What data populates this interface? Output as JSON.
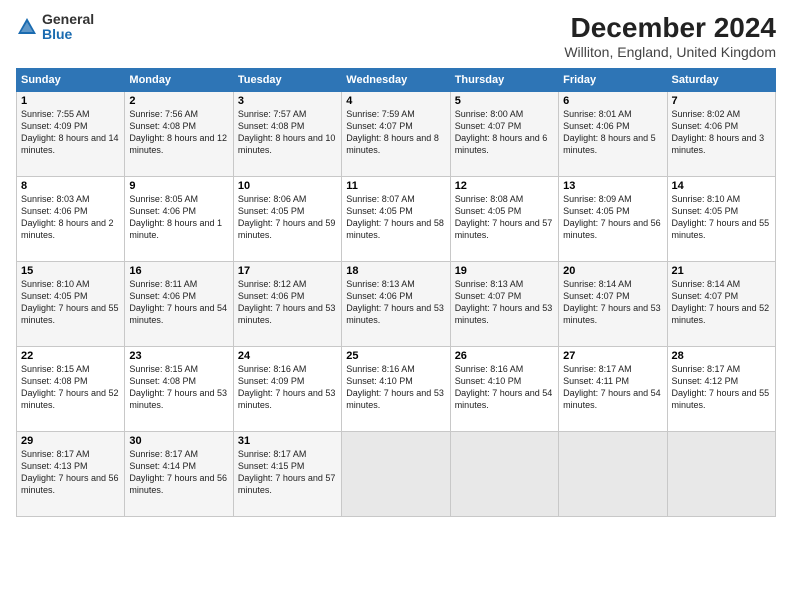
{
  "logo": {
    "general": "General",
    "blue": "Blue"
  },
  "title": "December 2024",
  "subtitle": "Williton, England, United Kingdom",
  "headers": [
    "Sunday",
    "Monday",
    "Tuesday",
    "Wednesday",
    "Thursday",
    "Friday",
    "Saturday"
  ],
  "weeks": [
    [
      {
        "day": "1",
        "sunrise": "7:55 AM",
        "sunset": "4:09 PM",
        "daylight": "8 hours and 14 minutes."
      },
      {
        "day": "2",
        "sunrise": "7:56 AM",
        "sunset": "4:08 PM",
        "daylight": "8 hours and 12 minutes."
      },
      {
        "day": "3",
        "sunrise": "7:57 AM",
        "sunset": "4:08 PM",
        "daylight": "8 hours and 10 minutes."
      },
      {
        "day": "4",
        "sunrise": "7:59 AM",
        "sunset": "4:07 PM",
        "daylight": "8 hours and 8 minutes."
      },
      {
        "day": "5",
        "sunrise": "8:00 AM",
        "sunset": "4:07 PM",
        "daylight": "8 hours and 6 minutes."
      },
      {
        "day": "6",
        "sunrise": "8:01 AM",
        "sunset": "4:06 PM",
        "daylight": "8 hours and 5 minutes."
      },
      {
        "day": "7",
        "sunrise": "8:02 AM",
        "sunset": "4:06 PM",
        "daylight": "8 hours and 3 minutes."
      }
    ],
    [
      {
        "day": "8",
        "sunrise": "8:03 AM",
        "sunset": "4:06 PM",
        "daylight": "8 hours and 2 minutes."
      },
      {
        "day": "9",
        "sunrise": "8:05 AM",
        "sunset": "4:06 PM",
        "daylight": "8 hours and 1 minute."
      },
      {
        "day": "10",
        "sunrise": "8:06 AM",
        "sunset": "4:05 PM",
        "daylight": "7 hours and 59 minutes."
      },
      {
        "day": "11",
        "sunrise": "8:07 AM",
        "sunset": "4:05 PM",
        "daylight": "7 hours and 58 minutes."
      },
      {
        "day": "12",
        "sunrise": "8:08 AM",
        "sunset": "4:05 PM",
        "daylight": "7 hours and 57 minutes."
      },
      {
        "day": "13",
        "sunrise": "8:09 AM",
        "sunset": "4:05 PM",
        "daylight": "7 hours and 56 minutes."
      },
      {
        "day": "14",
        "sunrise": "8:10 AM",
        "sunset": "4:05 PM",
        "daylight": "7 hours and 55 minutes."
      }
    ],
    [
      {
        "day": "15",
        "sunrise": "8:10 AM",
        "sunset": "4:05 PM",
        "daylight": "7 hours and 55 minutes."
      },
      {
        "day": "16",
        "sunrise": "8:11 AM",
        "sunset": "4:06 PM",
        "daylight": "7 hours and 54 minutes."
      },
      {
        "day": "17",
        "sunrise": "8:12 AM",
        "sunset": "4:06 PM",
        "daylight": "7 hours and 53 minutes."
      },
      {
        "day": "18",
        "sunrise": "8:13 AM",
        "sunset": "4:06 PM",
        "daylight": "7 hours and 53 minutes."
      },
      {
        "day": "19",
        "sunrise": "8:13 AM",
        "sunset": "4:07 PM",
        "daylight": "7 hours and 53 minutes."
      },
      {
        "day": "20",
        "sunrise": "8:14 AM",
        "sunset": "4:07 PM",
        "daylight": "7 hours and 53 minutes."
      },
      {
        "day": "21",
        "sunrise": "8:14 AM",
        "sunset": "4:07 PM",
        "daylight": "7 hours and 52 minutes."
      }
    ],
    [
      {
        "day": "22",
        "sunrise": "8:15 AM",
        "sunset": "4:08 PM",
        "daylight": "7 hours and 52 minutes."
      },
      {
        "day": "23",
        "sunrise": "8:15 AM",
        "sunset": "4:08 PM",
        "daylight": "7 hours and 53 minutes."
      },
      {
        "day": "24",
        "sunrise": "8:16 AM",
        "sunset": "4:09 PM",
        "daylight": "7 hours and 53 minutes."
      },
      {
        "day": "25",
        "sunrise": "8:16 AM",
        "sunset": "4:10 PM",
        "daylight": "7 hours and 53 minutes."
      },
      {
        "day": "26",
        "sunrise": "8:16 AM",
        "sunset": "4:10 PM",
        "daylight": "7 hours and 54 minutes."
      },
      {
        "day": "27",
        "sunrise": "8:17 AM",
        "sunset": "4:11 PM",
        "daylight": "7 hours and 54 minutes."
      },
      {
        "day": "28",
        "sunrise": "8:17 AM",
        "sunset": "4:12 PM",
        "daylight": "7 hours and 55 minutes."
      }
    ],
    [
      {
        "day": "29",
        "sunrise": "8:17 AM",
        "sunset": "4:13 PM",
        "daylight": "7 hours and 56 minutes."
      },
      {
        "day": "30",
        "sunrise": "8:17 AM",
        "sunset": "4:14 PM",
        "daylight": "7 hours and 56 minutes."
      },
      {
        "day": "31",
        "sunrise": "8:17 AM",
        "sunset": "4:15 PM",
        "daylight": "7 hours and 57 minutes."
      },
      null,
      null,
      null,
      null
    ]
  ]
}
